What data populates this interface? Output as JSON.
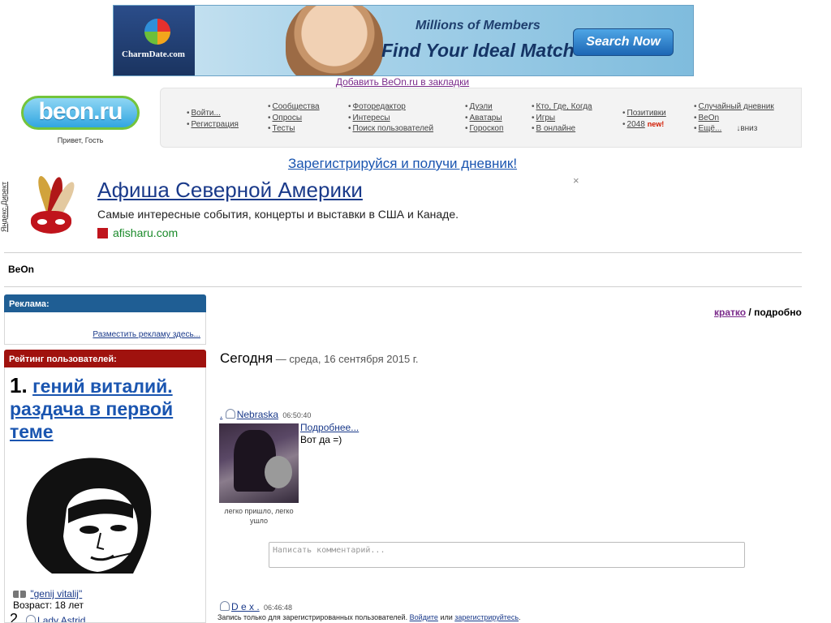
{
  "banner": {
    "brand": "CharmDate.com",
    "line1": "Millions of Members",
    "line2": "Find Your Ideal Match",
    "button": "Search Now"
  },
  "bookmark_link": "Добавить BeOn.ru в закладки",
  "logo": {
    "text": "beon.ru"
  },
  "greeting": "Привет, Гость",
  "menu": {
    "col1": [
      "Войти...",
      "Регистрация"
    ],
    "col2": [
      "Сообщества",
      "Опросы",
      "Тесты"
    ],
    "col3": [
      "Фоторедактор",
      "Интересы",
      "Поиск пользователей"
    ],
    "col4": [
      "Дуэли",
      "Аватары",
      "Гороскоп"
    ],
    "col5": [
      "Кто, Где, Когда",
      "Игры",
      "В онлайне"
    ],
    "col6": [
      "Позитивки",
      "2048"
    ],
    "new_badge": "new!",
    "col7": [
      "Случайный дневник",
      "BeOn",
      "Ещё..."
    ],
    "down": "↓вниз"
  },
  "register_call": "Зарегистрируйся и получи дневник!",
  "direct_ad": {
    "label": "Яндекс.Директ",
    "title": "Афиша Северной Америки",
    "text": "Самые интересные события, концерты и выставки в США и Канаде.",
    "site": "afisharu.com",
    "close": "×"
  },
  "section_title": "BeOn",
  "sidebar": {
    "ads_header": "Реклама:",
    "ads_link": "Разместить рекламу здесь...",
    "rating_header": "Рейтинг пользователей:",
    "rank1_num": "1.",
    "rank1_title": "гений виталий. раздача в первой теме",
    "rank1_user": "\"genij vitalij\"",
    "rank1_age": "Возраст: 18 лет",
    "rank2_num": "2.",
    "rank2_user": "Lady Astrid"
  },
  "main": {
    "view_short": "кратко",
    "view_sep": " / ",
    "view_full": "подробно",
    "today_label": "Сегодня",
    "today_date": " — среда, 16 сентября 2015 г.",
    "post1": {
      "dot": ".",
      "author": "Nebraska",
      "time": "06:50:40",
      "more": "Подробнее...",
      "text": "Вот да =)",
      "caption": "легко пришло, легко ушло"
    },
    "comment_placeholder": "Написать комментарий...",
    "post2": {
      "author": "D e x .",
      "time": "06:46:48"
    },
    "login_note_pre": "Запись только для зарегистрированных пользователей. ",
    "login_link": "Войдите",
    "login_mid": " или ",
    "register_link": "зарегистрируйтесь",
    "login_end": "."
  },
  "colors": {
    "ads_header": "#1f5e94",
    "rating_header": "#a0120e",
    "link": "#1a3a8a"
  }
}
